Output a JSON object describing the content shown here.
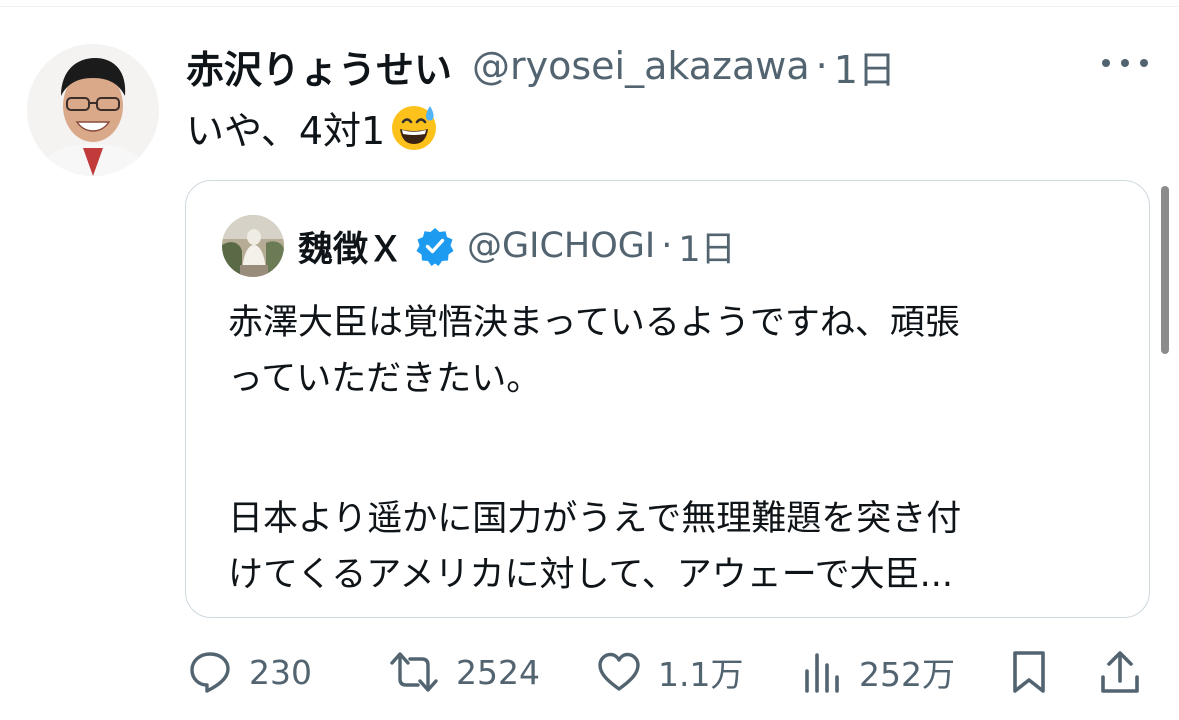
{
  "tweet": {
    "display_name": "赤沢りょうせい",
    "handle": "@ryosei_akazawa",
    "separator": "·",
    "time": "1日",
    "text": "いや、4対1",
    "emoji": "grinning-face-with-sweat"
  },
  "quote": {
    "display_name": "魏徴Ｘ",
    "verified": true,
    "handle": "@GICHOGI",
    "separator": "·",
    "time": "1日",
    "paragraphs": [
      [
        "赤澤大臣は覚悟決まっているようですね、頑張",
        "っていただきたい。"
      ],
      [
        "日本より遥かに国力がうえで無理難題を突き付",
        "けてくるアメリカに対して、アウェーで大臣..."
      ]
    ]
  },
  "actions": {
    "reply": {
      "icon": "reply-icon",
      "count": "230"
    },
    "retweet": {
      "icon": "retweet-icon",
      "count": "2524"
    },
    "like": {
      "icon": "heart-icon",
      "count": "1.1万"
    },
    "views": {
      "icon": "views-icon",
      "count": "252万"
    },
    "bookmark": {
      "icon": "bookmark-icon"
    },
    "share": {
      "icon": "share-icon"
    }
  },
  "colors": {
    "text": "#0f1419",
    "secondary": "#536471",
    "border": "#cfd9de",
    "verified": "#1d9bf0"
  }
}
